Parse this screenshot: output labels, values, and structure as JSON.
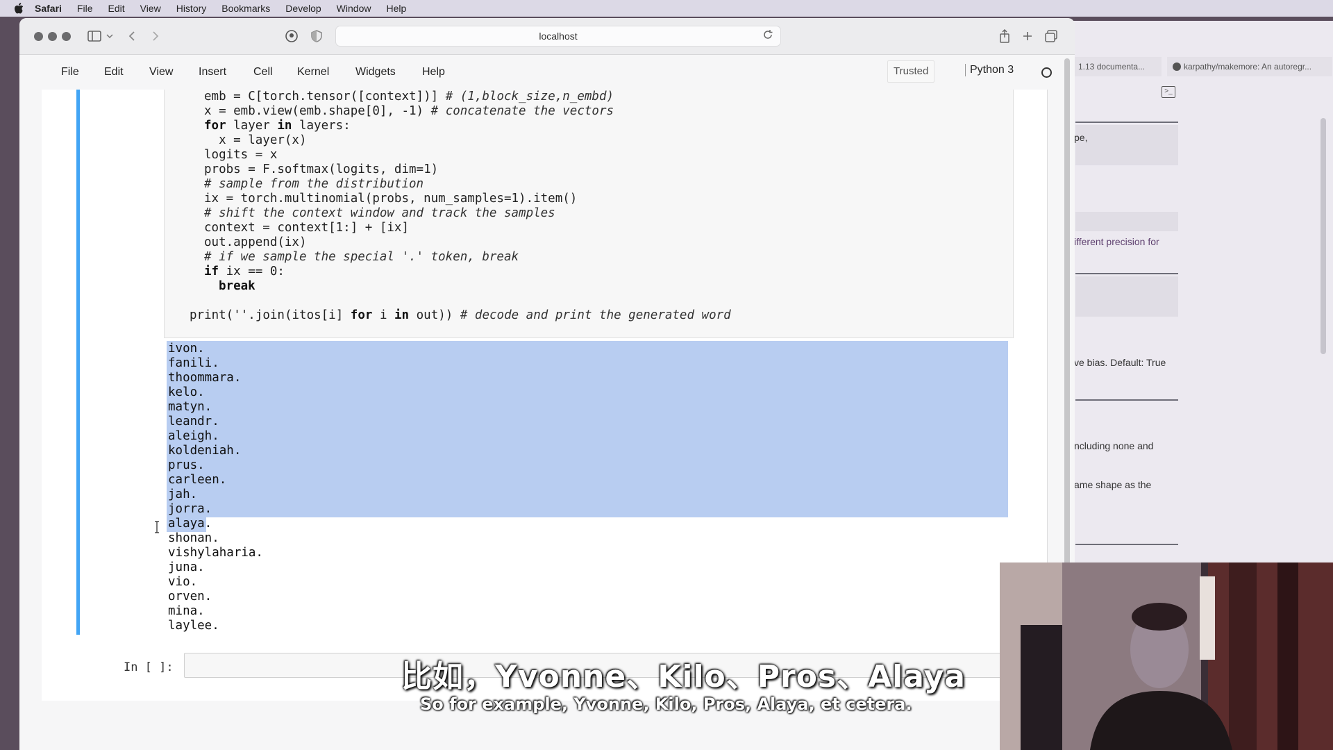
{
  "menubar": {
    "app": "Safari",
    "items": [
      "File",
      "Edit",
      "View",
      "History",
      "Bookmarks",
      "Develop",
      "Window",
      "Help"
    ]
  },
  "browser": {
    "url": "localhost"
  },
  "jupyter": {
    "menu": [
      "File",
      "Edit",
      "View",
      "Insert",
      "Cell",
      "Kernel",
      "Widgets",
      "Help"
    ],
    "trusted": "Trusted",
    "kernel": "Python 3"
  },
  "code_lines": [
    "emb = C[torch.tensor([context])] # (1,block_size,n_embd)",
    "x = emb.view(emb.shape[0], -1) # concatenate the vectors",
    "for layer in layers:",
    "  x = layer(x)",
    "logits = x",
    "probs = F.softmax(logits, dim=1)",
    "# sample from the distribution",
    "ix = torch.multinomial(probs, num_samples=1).item()",
    "# shift the context window and track the samples",
    "context = context[1:] + [ix]",
    "out.append(ix)",
    "# if we sample the special '.' token, break",
    "if ix == 0:",
    "  break",
    "",
    "print(''.join(itos[i] for i in out)) # decode and print the generated word"
  ],
  "output_lines": [
    "ivon.",
    "fanili.",
    "thoommara.",
    "kelo.",
    "matyn.",
    "leandr.",
    "aleigh.",
    "koldeniah.",
    "prus.",
    "carleen.",
    "jah.",
    "jorra.",
    "alaya.",
    "shonan.",
    "vishylaharia.",
    "juna.",
    "vio.",
    "orven.",
    "mina.",
    "laylee."
  ],
  "input_prompt": "In [ ]:",
  "docs_pane": {
    "tabs": [
      "1.13 documenta...",
      "karpathy/makemore: An autoregr..."
    ],
    "snippets": [
      "pe,",
      "ifferent precision for",
      "ve bias. Default: True",
      "ncluding none and",
      "ame shape as the"
    ]
  },
  "subtitles": {
    "zh": "比如，Yvonne、Kilo、Pros、Alaya",
    "en": "So for example, Yvonne, Kilo, Pros, Alaya, et cetera."
  }
}
